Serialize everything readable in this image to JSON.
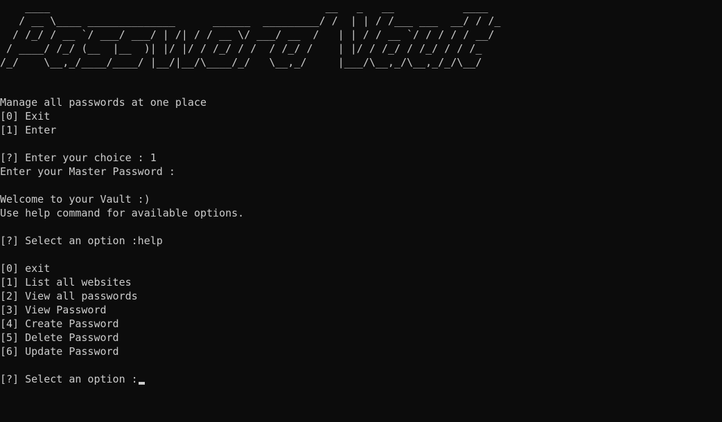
{
  "banner": {
    "ascii_art": "    ____                                            __   _   __           ____\n   / __ \\____ ______________      ______  _________/ /  | | / /___ ___  __/ / /_\n  / /_/ / __ `/ ___/ ___/ | /| / / __ \\/ ___/ __  /   | | / / __ `/ / / / / __/\n / ____/ /_/ (__  |__  )| |/ |/ / /_/ / /  / /_/ /    | |/ / /_/ / /_/ / / /_\n/_/    \\__,_/____/____/ |__/|__/\\____/_/   \\__,_/     |___/\\__,_/\\__,_/_/\\__/"
  },
  "terminal": {
    "lines": [
      "Manage all passwords at one place",
      "[0] Exit",
      "[1] Enter",
      "",
      "[?] Enter your choice : 1",
      "Enter your Master Password :",
      "",
      "Welcome to your Vault :)",
      "Use help command for available options.",
      "",
      "[?] Select an option :help",
      "",
      "[0] exit",
      "[1] List all websites",
      "[2] View all passwords",
      "[3] View Password",
      "[4] Create Password",
      "[5] Delete Password",
      "[6] Update Password",
      "",
      "[?] Select an option :"
    ]
  },
  "colors": {
    "background": "#0c0c0c",
    "foreground": "#cccccc"
  }
}
